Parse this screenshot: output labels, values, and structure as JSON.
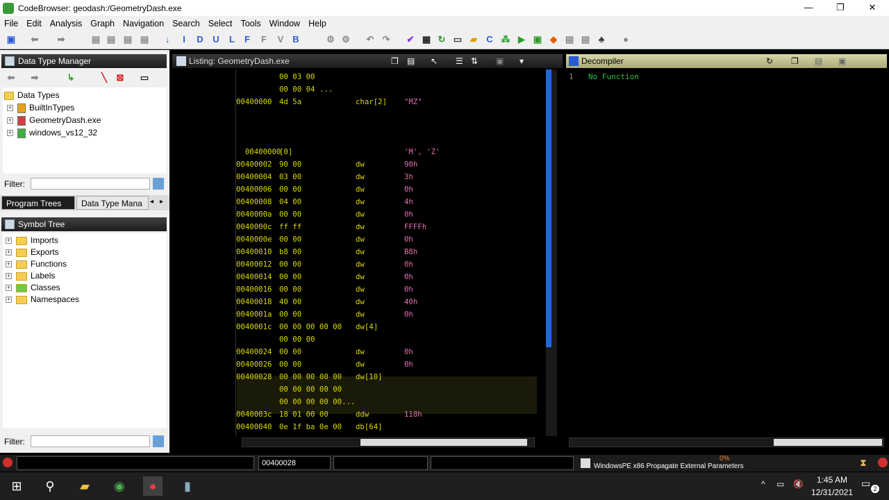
{
  "window": {
    "title": "CodeBrowser: geodash:/GeometryDash.exe",
    "minimize": "—",
    "restore": "❐",
    "close": "✕"
  },
  "menu": [
    "File",
    "Edit",
    "Analysis",
    "Graph",
    "Navigation",
    "Search",
    "Select",
    "Tools",
    "Window",
    "Help"
  ],
  "data_type_manager": {
    "title": "Data Type Manager",
    "root": "Data Types",
    "items": [
      "BuiltInTypes",
      "GeometryDash.exe",
      "windows_vs12_32"
    ],
    "filter_label": "Filter:"
  },
  "tabs": [
    "Program Trees",
    "Data Type Mana"
  ],
  "symbol_tree": {
    "title": "Symbol Tree",
    "items": [
      "Imports",
      "Exports",
      "Functions",
      "Labels",
      "Classes",
      "Namespaces"
    ],
    "filter_label": "Filter:"
  },
  "listing": {
    "title": "Listing:  GeometryDash.exe",
    "rows": [
      {
        "addr": "",
        "bytes": "00 03 00",
        "mn": "",
        "val": ""
      },
      {
        "addr": "",
        "bytes": "00 00 04 ...",
        "mn": "",
        "val": ""
      },
      {
        "addr": "00400000",
        "bytes": "4d 5a",
        "mn": "char[2]",
        "val": "\"MZ\""
      },
      {
        "addr": "",
        "bytes": "",
        "mn": "",
        "val": ""
      },
      {
        "addr": "",
        "bytes": "",
        "mn": "",
        "val": ""
      },
      {
        "addr": "",
        "bytes": "",
        "mn": "",
        "val": ""
      },
      {
        "addr": "  00400000",
        "bytes": "[0]",
        "mn": "",
        "val": "'M', 'Z'"
      },
      {
        "addr": "00400002",
        "bytes": "90 00",
        "mn": "dw",
        "val": "90h"
      },
      {
        "addr": "00400004",
        "bytes": "03 00",
        "mn": "dw",
        "val": "3h"
      },
      {
        "addr": "00400006",
        "bytes": "00 00",
        "mn": "dw",
        "val": "0h"
      },
      {
        "addr": "00400008",
        "bytes": "04 00",
        "mn": "dw",
        "val": "4h"
      },
      {
        "addr": "0040000a",
        "bytes": "00 00",
        "mn": "dw",
        "val": "0h"
      },
      {
        "addr": "0040000c",
        "bytes": "ff ff",
        "mn": "dw",
        "val": "FFFFh"
      },
      {
        "addr": "0040000e",
        "bytes": "00 00",
        "mn": "dw",
        "val": "0h"
      },
      {
        "addr": "00400010",
        "bytes": "b8 00",
        "mn": "dw",
        "val": "B8h"
      },
      {
        "addr": "00400012",
        "bytes": "00 00",
        "mn": "dw",
        "val": "0h"
      },
      {
        "addr": "00400014",
        "bytes": "00 00",
        "mn": "dw",
        "val": "0h"
      },
      {
        "addr": "00400016",
        "bytes": "00 00",
        "mn": "dw",
        "val": "0h"
      },
      {
        "addr": "00400018",
        "bytes": "40 00",
        "mn": "dw",
        "val": "40h"
      },
      {
        "addr": "0040001a",
        "bytes": "00 00",
        "mn": "dw",
        "val": "0h"
      },
      {
        "addr": "0040001c",
        "bytes": "00 00 00 00 00",
        "mn": "dw[4]",
        "val": ""
      },
      {
        "addr": "",
        "bytes": "00 00 00",
        "mn": "",
        "val": ""
      },
      {
        "addr": "00400024",
        "bytes": "00 00",
        "mn": "dw",
        "val": "0h"
      },
      {
        "addr": "00400026",
        "bytes": "00 00",
        "mn": "dw",
        "val": "0h"
      },
      {
        "addr": "00400028",
        "bytes": "00 00 00 00 00",
        "mn": "dw[10]",
        "val": ""
      },
      {
        "addr": "",
        "bytes": "00 00 00 00 00",
        "mn": "",
        "val": ""
      },
      {
        "addr": "",
        "bytes": "00 00 00 00 00...",
        "mn": "",
        "val": ""
      },
      {
        "addr": "0040003c",
        "bytes": "18 01 00 00",
        "mn": "ddw",
        "val": "118h"
      },
      {
        "addr": "00400040",
        "bytes": "0e 1f ba 0e 00",
        "mn": "db[64]",
        "val": ""
      }
    ]
  },
  "decompiler": {
    "title": "Decompiler",
    "line_no": "1",
    "text": "No Function"
  },
  "status": {
    "address": "00400028",
    "progress": "0%",
    "task": "WindowsPE x86 Propagate External Parameters"
  },
  "taskbar": {
    "time": "1:45 AM",
    "date": "12/31/2021",
    "notif": "2"
  },
  "colors": {
    "accent_yellow": "#d8d800",
    "value_pink": "#e070b0",
    "decomp_green": "#2ebf4a"
  }
}
